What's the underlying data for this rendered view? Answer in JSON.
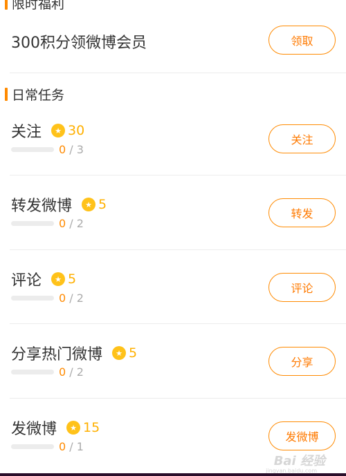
{
  "limited_section": {
    "title": "限时福利",
    "item": {
      "text": "300积分领微博会员",
      "button": "领取"
    }
  },
  "daily_section": {
    "title": "日常任务",
    "tasks": [
      {
        "name": "关注",
        "points": "30",
        "done": "0",
        "total": "/ 3",
        "button": "关注"
      },
      {
        "name": "转发微博",
        "points": "5",
        "done": "0",
        "total": "/ 2",
        "button": "转发"
      },
      {
        "name": "评论",
        "points": "5",
        "done": "0",
        "total": "/ 2",
        "button": "评论"
      },
      {
        "name": "分享热门微博",
        "points": "5",
        "done": "0",
        "total": "/ 2",
        "button": "分享"
      },
      {
        "name": "发微博",
        "points": "15",
        "done": "0",
        "total": "/ 1",
        "button": "发微博"
      }
    ]
  },
  "coin_icon": "star-coin-icon",
  "colors": {
    "accent": "#ff8a00",
    "coin": "#ffc21a",
    "progress_done": "#ff8a00",
    "progress_total": "#aaaaaa"
  },
  "watermark": {
    "text": "Bai 经验",
    "sub": "jingyan.baidu.com"
  }
}
